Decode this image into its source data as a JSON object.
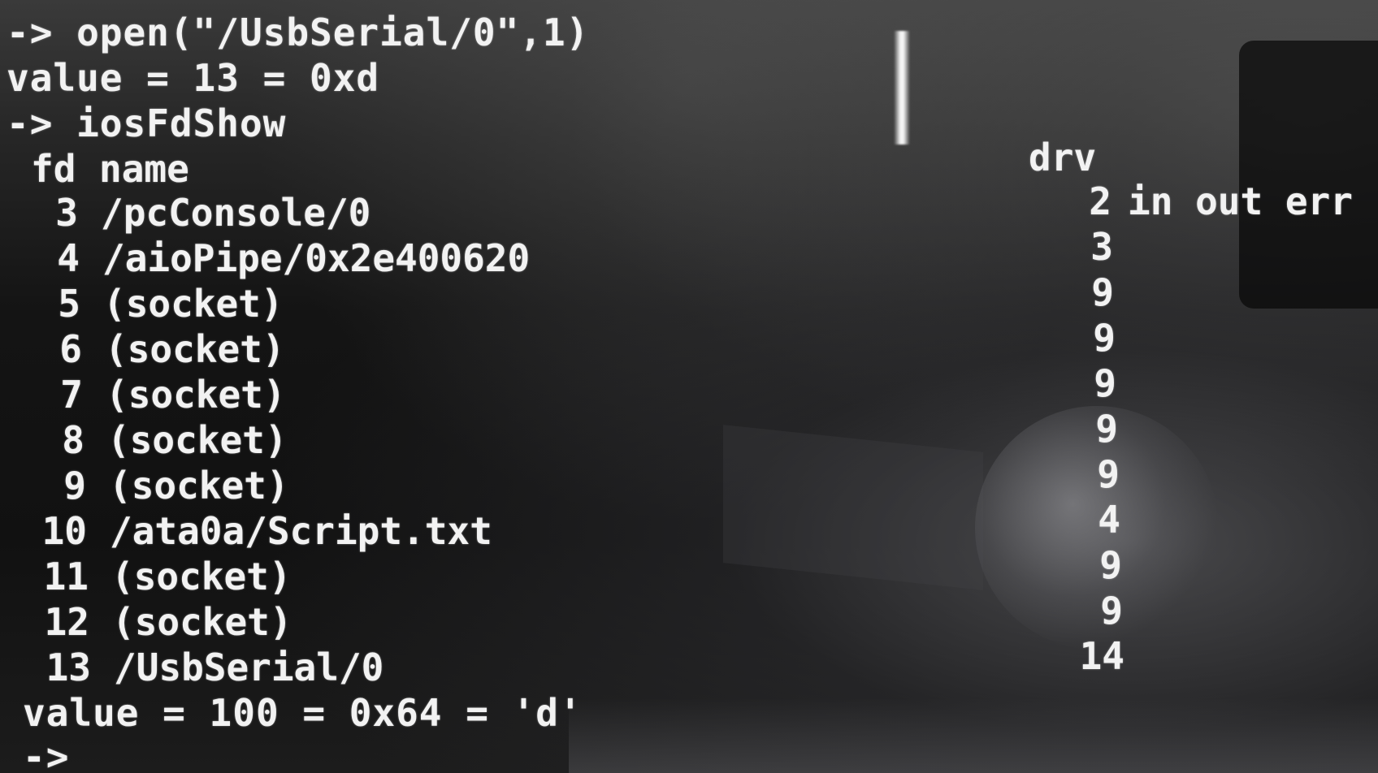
{
  "terminal": {
    "lines": {
      "cmd_open": "-> open(\"/UsbSerial/0\",1)",
      "result_open": "value = 13 = 0xd",
      "cmd_show": "-> iosFdShow",
      "result_show": "value = 100 = 0x64 = 'd'",
      "prompt": "->"
    },
    "table": {
      "header_fd": "fd",
      "header_name": "name",
      "header_drv": "drv",
      "rows": [
        {
          "fd": "3",
          "name": "/pcConsole/0",
          "drv": "2",
          "flags": "in out err"
        },
        {
          "fd": "4",
          "name": "/aioPipe/0x2e400620",
          "drv": "3",
          "flags": ""
        },
        {
          "fd": "5",
          "name": "(socket)",
          "drv": "9",
          "flags": ""
        },
        {
          "fd": "6",
          "name": "(socket)",
          "drv": "9",
          "flags": ""
        },
        {
          "fd": "7",
          "name": "(socket)",
          "drv": "9",
          "flags": ""
        },
        {
          "fd": "8",
          "name": "(socket)",
          "drv": "9",
          "flags": ""
        },
        {
          "fd": "9",
          "name": "(socket)",
          "drv": "9",
          "flags": ""
        },
        {
          "fd": "10",
          "name": "/ata0a/Script.txt",
          "drv": "4",
          "flags": ""
        },
        {
          "fd": "11",
          "name": "(socket)",
          "drv": "9",
          "flags": ""
        },
        {
          "fd": "12",
          "name": "(socket)",
          "drv": "9",
          "flags": ""
        },
        {
          "fd": "13",
          "name": "/UsbSerial/0",
          "drv": "14",
          "flags": ""
        }
      ]
    }
  }
}
